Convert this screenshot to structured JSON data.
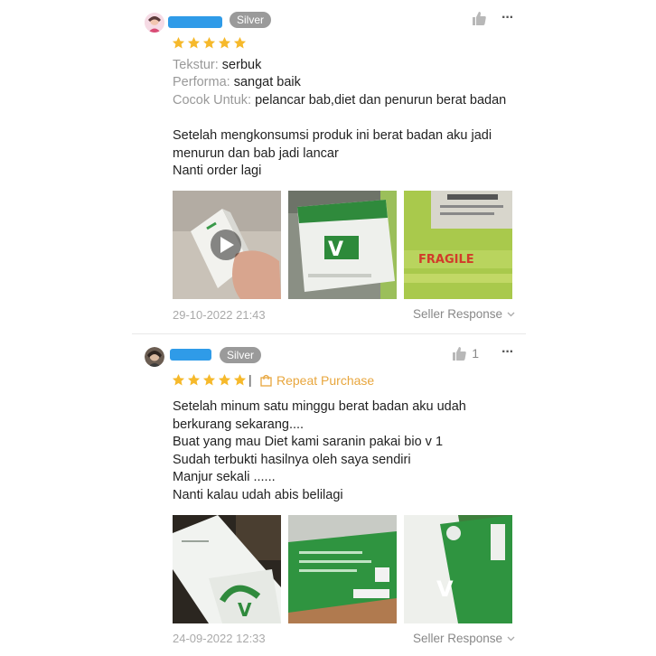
{
  "reviews": [
    {
      "badge": "Silver",
      "stars": 5,
      "attributes": [
        {
          "key": "Tekstur:",
          "value": "serbuk"
        },
        {
          "key": "Performa:",
          "value": "sangat baik"
        },
        {
          "key": "Cocok Untuk:",
          "value": "pelancar bab,diet dan penurun berat badan"
        }
      ],
      "text": "Setelah mengkonsumsi produk ini berat badan aku jadi\nmenurun dan bab jadi lancar\nNanti order lagi",
      "date": "29-10-2022 21:43",
      "seller_response": "Seller Response"
    },
    {
      "badge": "Silver",
      "likes": "1",
      "stars": 5,
      "tag": "Repeat Purchase",
      "text": "Setelah minum satu  minggu berat badan aku udah\nberkurang sekarang....\nBuat  yang mau Diet kami  saranin pakai  bio v 1\nSudah  terbukti  hasilnya oleh  saya sendiri\nManjur  sekali ......\nNanti  kalau  udah  abis  belilagi",
      "date": "24-09-2022 12:33",
      "seller_response": "Seller Response"
    }
  ],
  "colors": {
    "star": "#f6b92b",
    "badge": "#9a9a9a",
    "username": "#2f9be8",
    "repeat": "#e8a63d"
  },
  "icons": [
    "thumbs-up-icon",
    "more-icon",
    "star-icon",
    "bag-icon",
    "chevron-down-icon",
    "play-icon"
  ]
}
